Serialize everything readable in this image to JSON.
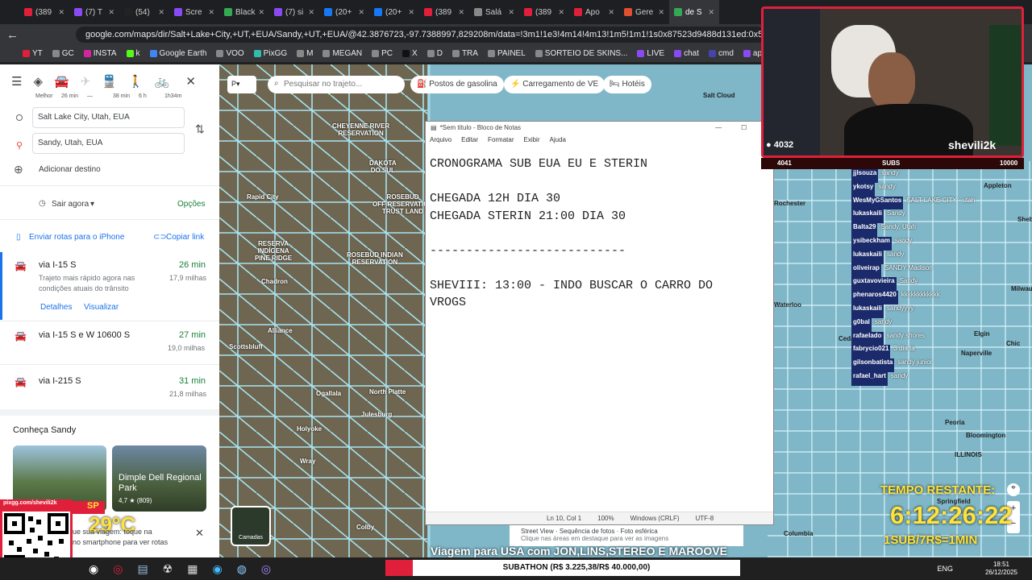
{
  "browser": {
    "tabs": [
      {
        "label": "(389",
        "color": "#e0203a"
      },
      {
        "label": "(7) T",
        "color": "#8a4af3"
      },
      {
        "label": "(54)",
        "color": "#222222"
      },
      {
        "label": "Scre",
        "color": "#8a4af3"
      },
      {
        "label": "Black",
        "color": "#34a853"
      },
      {
        "label": "(7) si",
        "color": "#8a4af3"
      },
      {
        "label": "(20+",
        "color": "#1877f2"
      },
      {
        "label": "(20+",
        "color": "#1877f2"
      },
      {
        "label": "(389",
        "color": "#e0203a"
      },
      {
        "label": "Salá",
        "color": "#888888"
      },
      {
        "label": "(389",
        "color": "#e0203a"
      },
      {
        "label": "Apo",
        "color": "#e0203a"
      },
      {
        "label": "Gere",
        "color": "#e04f2f"
      },
      {
        "label": "de S",
        "color": "#34a853",
        "active": true
      }
    ],
    "url": "google.com/maps/dir/Salt+Lake+City,+UT,+EUA/Sandy,+UT,+EUA/@42.3876723,-97.7388997,829208m/data=!3m1!1e3!4m14!4m13!1m5!1m1!1s0x87523d9488d131ed:0x5b53b7a0484d31ca!2m2!1d-111.8",
    "bookmarks": [
      {
        "label": "YT",
        "color": "#e0203a"
      },
      {
        "label": "GC",
        "color": "#888888"
      },
      {
        "label": "INSTA",
        "color": "#d6249f"
      },
      {
        "label": "k",
        "color": "#53fc18"
      },
      {
        "label": "Google Earth",
        "color": "#4285f4"
      },
      {
        "label": "VOO",
        "color": "#888888"
      },
      {
        "label": "PixGG",
        "color": "#32bcad"
      },
      {
        "label": "M",
        "color": "#888888"
      },
      {
        "label": "MEGAN",
        "color": "#888888"
      },
      {
        "label": "PC",
        "color": "#888888"
      },
      {
        "label": "X",
        "color": "#111111"
      },
      {
        "label": "D",
        "color": "#888888"
      },
      {
        "label": "TRA",
        "color": "#888888"
      },
      {
        "label": "PAINEL",
        "color": "#888888"
      },
      {
        "label": "SORTEIO DE SKINS...",
        "color": "#888888"
      },
      {
        "label": "LIVE",
        "color": "#8a4af3"
      },
      {
        "label": "chat",
        "color": "#8a4af3"
      },
      {
        "label": "cmd",
        "color": "#4444aa"
      },
      {
        "label": "apostasCHAT",
        "color": "#8a4af3"
      }
    ]
  },
  "maps": {
    "modes": [
      "Melhor",
      "26 min",
      "—",
      "38 min",
      "6 h",
      "1h34m"
    ],
    "origin": "Salt Lake City, Utah, EUA",
    "destination": "Sandy, Utah, EUA",
    "add_destination": "Adicionar destino",
    "leave_now": "Sair agora",
    "options": "Opções",
    "send_to_phone": "Enviar rotas para o iPhone",
    "copy_link": "Copiar link",
    "routes": [
      {
        "name": "via I-15 S",
        "time": "26 min",
        "dist": "17,9 milhas",
        "desc": "Trajeto mais rápido agora nas condições atuais do trânsito",
        "details": "Detalhes",
        "view": "Visualizar"
      },
      {
        "name": "via I-15 S e W 10600 S",
        "time": "27 min",
        "dist": "19,0 milhas"
      },
      {
        "name": "via I-215 S",
        "time": "31 min",
        "dist": "21,8 milhas"
      }
    ],
    "know_title": "Conheça Sandy",
    "card_title": "Dimple Dell Regional Park",
    "card_rating": "4,7 ★ (809)",
    "weather": "29°C",
    "weather_text1": "ue sua viagem: toque na",
    "weather_text2": "no smartphone para ver rotas",
    "map_search_placeholder": "Pesquisar no trajeto...",
    "chips": [
      "Postos de gasolina",
      "Carregamento de VE",
      "Hotéis"
    ],
    "layers": "Camadas",
    "footer_links": [
      "Street View",
      "Sequência de fotos",
      "Foto esférica"
    ],
    "footer_hint": "Clique nas áreas em destaque para ver as imagens",
    "map_labels": [
      {
        "t": "CHEYENNE RIVER\nRESERVATION"
      },
      {
        "t": "DAKOTA\nDO SUL"
      },
      {
        "t": "Rapid City"
      },
      {
        "t": "ROSEBUD\nOFF-RESERVATION\nTRUST LAND"
      },
      {
        "t": "RESERVA\nINDÍGENA\nPINE RIDGE"
      },
      {
        "t": "ROSEBUD INDIAN\nRESERVATION"
      },
      {
        "t": "Chadron"
      },
      {
        "t": "Alliance"
      },
      {
        "t": "Scottsbluff"
      },
      {
        "t": "North Platte"
      },
      {
        "t": "Ogallala"
      },
      {
        "t": "Julesburg"
      },
      {
        "t": "Holyoke"
      },
      {
        "t": "Wray"
      },
      {
        "t": "Colby"
      },
      {
        "t": "Rochester"
      },
      {
        "t": "Waterloo"
      },
      {
        "t": "Cedar Rapids"
      },
      {
        "t": "Milwaukee"
      },
      {
        "t": "Chic"
      },
      {
        "t": "Naperville"
      },
      {
        "t": "Peoria"
      },
      {
        "t": "ILLINOIS"
      },
      {
        "t": "Bloomington"
      },
      {
        "t": "Springfield"
      },
      {
        "t": "Columbia"
      },
      {
        "t": "Elgin"
      },
      {
        "t": "Appleton"
      },
      {
        "t": "Sheboy"
      },
      {
        "t": "Salt Cloud"
      }
    ]
  },
  "notepad": {
    "title": "*Sem título - Bloco de Notas",
    "menu": [
      "Arquivo",
      "Editar",
      "Formatar",
      "Exibir",
      "Ajuda"
    ],
    "content": "CRONOGRAMA SUB EUA EU E STERIN\n\nCHEGADA 12H DIA 30\nCHEGADA STERIN 21:00 DIA 30\n\n---------------------------\n\nSHEVIII: 13:00 - INDO BUSCAR O CARRO DO\nVROGS",
    "status": [
      "Ln 10, Col 1",
      "100%",
      "Windows (CRLF)",
      "UTF-8"
    ]
  },
  "stream": {
    "viewers": "4032",
    "name": "shevili2k",
    "subs_left": "4041",
    "subs_label": "SUBS",
    "subs_right": "10000",
    "chat": [
      {
        "u": "jjlsouza",
        "m": "sandy"
      },
      {
        "u": "ykotsy",
        "m": "sandy"
      },
      {
        "u": "WesMyGSantos",
        "m": "SALT LAKE CITY - utah"
      },
      {
        "u": "lukaskaili",
        "m": "Sandy"
      },
      {
        "u": "Balta29",
        "m": "Sandy, Utah"
      },
      {
        "u": "ysibeckham",
        "m": "sandy"
      },
      {
        "u": "lukaskaili",
        "m": "sandy"
      },
      {
        "u": "oliveirap",
        "m": "SANDY Madison"
      },
      {
        "u": "guxtavovieira",
        "m": "Sandy"
      },
      {
        "u": "phenaros4420",
        "m": "kkkkkkkkkkkk"
      },
      {
        "u": "lukaskaili",
        "m": "sandyyyy"
      },
      {
        "u": "g0bal",
        "m": "sandy"
      },
      {
        "u": "rafaelado",
        "m": "sandy shores"
      },
      {
        "u": "fabrycio021",
        "m": "3 dia ta"
      },
      {
        "u": "gilsonbatista",
        "m": "sandy junior"
      },
      {
        "u": "rafael_hart",
        "m": "sandy"
      }
    ],
    "timer_label": "TEMPO RESTANTE:",
    "timer": "6:12:26:22",
    "timer_rate": "1SUB/7R$=1MIN",
    "qr_handle": "pixgg.com/shevili2k",
    "sp": "SP",
    "banner": "Viagem para USA com JON,LINS,STEREO E MAROOVE",
    "subathon": "SUBATHON (R$ 3.225,38/R$ 40.000,00)"
  },
  "taskbar": {
    "lang": "ENG",
    "time": "18:51",
    "date": "26/12/2025"
  }
}
